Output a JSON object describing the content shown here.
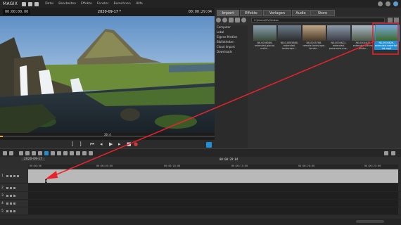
{
  "app": {
    "logo": "MAGIX",
    "menu": [
      "Datei",
      "Bearbeiten",
      "Effekte",
      "Fenster",
      "Berechnen",
      "Hilfe"
    ]
  },
  "preview": {
    "timecode_left": "00:00:00.00",
    "date_title": "2020-09-17 *",
    "timecode_right": "00:00:29:04",
    "scrub_marker": "20:4"
  },
  "media_pool": {
    "tabs": [
      "Import",
      "Effekte",
      "Vorlagen",
      "Audio",
      "Store"
    ],
    "active_tab": "Import",
    "path": "C:\\Users\\MV\\Videos",
    "nav": [
      "Computer",
      "Lokal",
      "Eigene Medien",
      "Bibliotheken",
      "Cloud Import",
      "Downloads"
    ],
    "thumbs": [
      {
        "label": "NK-0006586-extended-glacial-melts..."
      },
      {
        "label": "NK-0-0005680-extended-landscape-..."
      },
      {
        "label": "NK-0005768-remote-landscape-landsc..."
      },
      {
        "label": "NK-0004622-extended-panorama-mw..."
      },
      {
        "label": "NK-0004A37-extended-rainhe-photo..."
      },
      {
        "label": "NK-0004826-extended-waterfall-lak.mp4"
      }
    ]
  },
  "timeline": {
    "project_date": "2020-09-17",
    "ruler_labels": [
      "00:00:00",
      "00:00:05:00",
      "00:00:10:00",
      "00:00:15:00",
      "00:00:20:00",
      "00:00:25:00"
    ],
    "ruler_center": "00:00:29:04",
    "tracks": [
      "1",
      "2",
      "3",
      "4",
      "5",
      "6",
      "7"
    ]
  },
  "colors": {
    "accent": "#1f8fd6",
    "annotation_arrow": "#e8232a"
  }
}
